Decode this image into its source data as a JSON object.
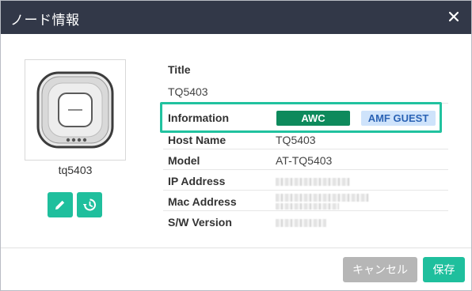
{
  "header": {
    "title": "ノード情報"
  },
  "device": {
    "name": "tq5403"
  },
  "info": {
    "title_label": "Title",
    "title_value": "TQ5403",
    "information_label": "Information",
    "tags": [
      "AWC",
      "AMF GUEST"
    ],
    "host_name_label": "Host Name",
    "host_name_value": "TQ5403",
    "model_label": "Model",
    "model_value": "AT-TQ5403",
    "ip_address_label": "IP Address",
    "mac_address_label": "Mac Address",
    "sw_version_label": "S/W Version"
  },
  "footer": {
    "cancel_label": "キャンセル",
    "save_label": "保存"
  },
  "colors": {
    "header_bg": "#323848",
    "accent_teal": "#1fbf9d",
    "highlight_border": "#21c29f",
    "tag_awc_bg": "#0e8a5c",
    "tag_amf_bg": "#cfe3fb",
    "tag_amf_text": "#2b63b5",
    "cancel_bg": "#b6b6b6"
  },
  "icons": [
    "close-icon",
    "access-point-icon",
    "edit-pencil-icon",
    "history-icon"
  ]
}
